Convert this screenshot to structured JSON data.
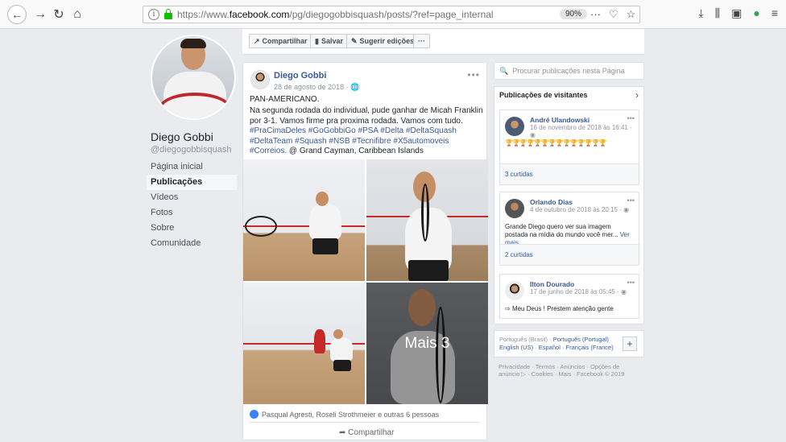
{
  "browser": {
    "url_prefix": "https://www.",
    "url_domain": "facebook.com",
    "url_path": "/pg/diegogobbisquash/posts/?ref=page_internal",
    "zoom": "90%"
  },
  "profile": {
    "name": "Diego Gobbi",
    "handle": "@diegogobbisquash",
    "nav": [
      "Página inicial",
      "Publicações",
      "Vídeos",
      "Fotos",
      "Sobre",
      "Comunidade"
    ]
  },
  "actionbar": {
    "share": "Compartilhar",
    "save": "Salvar",
    "suggest": "Sugerir edições",
    "more": "···"
  },
  "post": {
    "author": "Diego Gobbi",
    "date": "28 de agosto de 2018",
    "title": "PAN-AMERICANO.",
    "text_1": "Na segunda rodada do individual, pude ganhar de Micah Franklin por 3-1. Vamos firme pra proxima rodada. Vamos com tudo. ",
    "tags_1": "#PraCimaDeles #GoGobbiGo #PSA #Delta #DeltaSquash #DeltaTeam #Squash #NSB #Tecnifibre #X5automoveis #Correios.",
    "text_2": " @ Grand Cayman, Caribbean Islands",
    "more_photos": "Mais 3",
    "reactions": "Pasqual Agresti, Roseli Strothmeier e outras 6 pessoas",
    "share": "Compartilhar"
  },
  "sidebar": {
    "search_placeholder": "Procurar publicações nesta Página",
    "visitors_title": "Publicações de visitantes",
    "cards": [
      {
        "name": "André Ulandowski",
        "date": "16 de novembro de 2018 às 16:41",
        "body": "🏆🏆🏆🏆🏆🏆🏆🏆🏆🏆🏆🏆🏆🏆",
        "footer": "3 curtidas"
      },
      {
        "name": "Orlando Dias",
        "date": "4 de outubro de 2018 às 20:15",
        "body": "Grande Diego quero ver sua imagem postada na mídia do mundo você mer... ",
        "link": "Ver mais",
        "footer": "2 curtidas"
      },
      {
        "name": "Ilton Dourado",
        "date": "17 de junho de 2018 às 05:45",
        "body": "Meu Deus ! Prestem atenção gente"
      }
    ],
    "languages_plain": "Português (Brasil) · ",
    "languages_links": "Português (Portugal)\nEnglish (US) · Español · Français (France)",
    "footer": "Privacidade · Termos · Anúncios · Opções de anúncio ▷ · Cookies · Mais · Facebook © 2019"
  }
}
